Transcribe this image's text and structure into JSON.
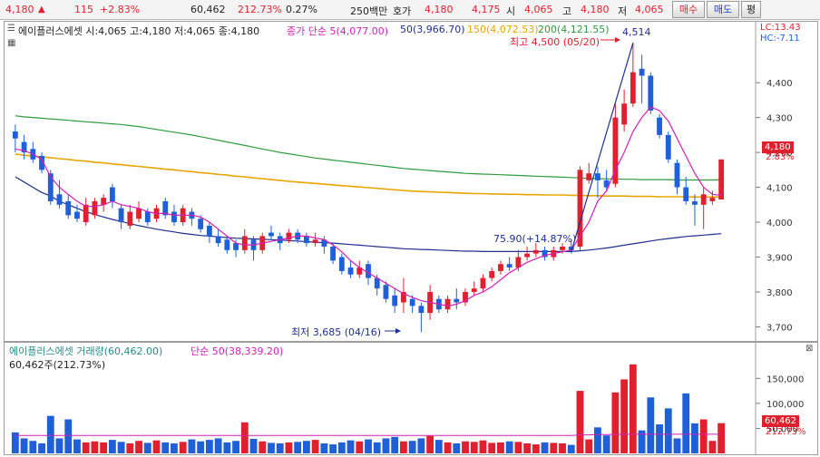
{
  "quote_bar": {
    "price": "4,180",
    "change_arrow": "▲",
    "change": "115",
    "change_pct": "+2.83%",
    "volume": "60,462",
    "volume_ratio": "212.73%",
    "turnover": "0.27%",
    "trade_value": "250백만",
    "ask_label": "호가",
    "ask1": "4,180",
    "ask2": "4,175",
    "open_label": "시",
    "open": "4,065",
    "high_label": "고",
    "high": "4,180",
    "low_label": "저",
    "low": "4,065",
    "buy_button": "매수",
    "sell_button": "매도",
    "eval_button": "평"
  },
  "colors": {
    "up": "#e0202e",
    "down": "#1f5fd8",
    "ma5": "#d21fb4",
    "ma50": "#1f2f8f",
    "ma150": "#e8a500",
    "ma200": "#2e9a3e",
    "vol_ma": "#d21fb4"
  },
  "legend": {
    "stock": "에이플러스에셋 시:4,065 고:4,180 저:4,065 종:4,180",
    "ma5": "종가 단순 5(4,077.00)",
    "ma50": "50(3,966.70)",
    "ma150": "150(4,072.53)",
    "ma200": "200(4,121.55)",
    "lc": "LC:13.43",
    "hc": "HC:-7.11"
  },
  "annotations": {
    "high_marker": "최고 4,500 (05/20)",
    "peak": "4,514",
    "low_marker": "최저 3,685 (04/16)",
    "trend": "75.90(+14.87%)"
  },
  "price_tag": {
    "price": "4,180",
    "pct": "2.83%"
  },
  "volume_legend": {
    "series": "에이플러스에셋 거래량(60,462.00)",
    "ma": "단순 50(38,339.20)",
    "last": "60,462주(212.73%)"
  },
  "volume_tag": {
    "value": "60,462",
    "pct": "212.73%"
  },
  "chart_data": {
    "type": "candlestick",
    "price_axis": {
      "ticks": [
        "4,400",
        "4,300",
        "4,200",
        "4,100",
        "4,000",
        "3,900",
        "3,800",
        "3,700"
      ],
      "ylim": [
        3670,
        4520
      ]
    },
    "volume_axis": {
      "ticks": [
        "150,000",
        "100,000",
        "50,000"
      ],
      "ylim": [
        0,
        185000
      ]
    },
    "candles": [
      [
        4260,
        4240,
        4280,
        4200
      ],
      [
        4230,
        4200,
        4250,
        4180
      ],
      [
        4210,
        4180,
        4230,
        4170
      ],
      [
        4190,
        4150,
        4200,
        4140
      ],
      [
        4140,
        4060,
        4150,
        4050
      ],
      [
        4080,
        4050,
        4120,
        4040
      ],
      [
        4060,
        4020,
        4080,
        4010
      ],
      [
        4030,
        4010,
        4050,
        4000
      ],
      [
        4000,
        4050,
        4070,
        3990
      ],
      [
        4020,
        4060,
        4070,
        4010
      ],
      [
        4050,
        4070,
        4080,
        4030
      ],
      [
        4100,
        4060,
        4110,
        4040
      ],
      [
        4040,
        4000,
        4050,
        3980
      ],
      [
        3990,
        4030,
        4050,
        3980
      ],
      [
        4010,
        4040,
        4060,
        4000
      ],
      [
        4030,
        4000,
        4040,
        3990
      ],
      [
        4010,
        4040,
        4050,
        4000
      ],
      [
        4060,
        4020,
        4070,
        4010
      ],
      [
        4030,
        4000,
        4050,
        3990
      ],
      [
        4000,
        4040,
        4050,
        3990
      ],
      [
        4030,
        4010,
        4040,
        3990
      ],
      [
        4010,
        3980,
        4020,
        3970
      ],
      [
        3990,
        3960,
        4000,
        3940
      ],
      [
        3960,
        3940,
        3980,
        3930
      ],
      [
        3950,
        3920,
        3960,
        3910
      ],
      [
        3940,
        3920,
        3950,
        3900
      ],
      [
        3920,
        3960,
        3980,
        3910
      ],
      [
        3950,
        3920,
        3960,
        3890
      ],
      [
        3920,
        3960,
        3970,
        3910
      ],
      [
        3970,
        3960,
        3990,
        3950
      ],
      [
        3960,
        3940,
        3970,
        3920
      ],
      [
        3950,
        3970,
        3980,
        3940
      ],
      [
        3970,
        3950,
        3980,
        3940
      ],
      [
        3960,
        3940,
        3970,
        3930
      ],
      [
        3940,
        3950,
        3970,
        3930
      ],
      [
        3950,
        3930,
        3960,
        3910
      ],
      [
        3930,
        3890,
        3940,
        3880
      ],
      [
        3900,
        3860,
        3910,
        3850
      ],
      [
        3870,
        3850,
        3890,
        3840
      ],
      [
        3850,
        3870,
        3890,
        3840
      ],
      [
        3880,
        3840,
        3890,
        3820
      ],
      [
        3840,
        3810,
        3850,
        3790
      ],
      [
        3820,
        3780,
        3830,
        3770
      ],
      [
        3790,
        3760,
        3810,
        3740
      ],
      [
        3770,
        3800,
        3840,
        3740
      ],
      [
        3780,
        3760,
        3790,
        3740
      ],
      [
        3760,
        3740,
        3770,
        3685
      ],
      [
        3740,
        3800,
        3820,
        3720
      ],
      [
        3780,
        3750,
        3790,
        3740
      ],
      [
        3750,
        3780,
        3790,
        3740
      ],
      [
        3780,
        3770,
        3810,
        3750
      ],
      [
        3770,
        3800,
        3810,
        3760
      ],
      [
        3800,
        3810,
        3830,
        3790
      ],
      [
        3810,
        3840,
        3850,
        3800
      ],
      [
        3840,
        3860,
        3870,
        3830
      ],
      [
        3860,
        3880,
        3890,
        3850
      ],
      [
        3880,
        3870,
        3900,
        3860
      ],
      [
        3870,
        3900,
        3920,
        3860
      ],
      [
        3900,
        3910,
        3930,
        3890
      ],
      [
        3910,
        3920,
        3940,
        3900
      ],
      [
        3920,
        3900,
        3930,
        3890
      ],
      [
        3900,
        3920,
        3930,
        3890
      ],
      [
        3920,
        3930,
        3940,
        3910
      ],
      [
        3930,
        3920,
        3950,
        3910
      ],
      [
        3930,
        4150,
        4160,
        3920
      ],
      [
        4120,
        4140,
        4170,
        4110
      ],
      [
        4140,
        4120,
        4160,
        4070
      ],
      [
        4120,
        4100,
        4150,
        4090
      ],
      [
        4110,
        4300,
        4340,
        4100
      ],
      [
        4280,
        4340,
        4380,
        4260
      ],
      [
        4340,
        4430,
        4514,
        4330
      ],
      [
        4440,
        4420,
        4480,
        4340
      ],
      [
        4420,
        4320,
        4430,
        4310
      ],
      [
        4300,
        4250,
        4310,
        4240
      ],
      [
        4250,
        4180,
        4260,
        4170
      ],
      [
        4170,
        4100,
        4180,
        4080
      ],
      [
        4100,
        4060,
        4130,
        4050
      ],
      [
        4060,
        4050,
        4080,
        3990
      ],
      [
        4050,
        4080,
        4100,
        3980
      ],
      [
        4060,
        4070,
        4090,
        4050
      ],
      [
        4065,
        4180,
        4180,
        4065
      ]
    ],
    "volume": [
      42000,
      30000,
      25000,
      20000,
      75000,
      30000,
      68000,
      28000,
      22000,
      24000,
      22000,
      27000,
      23000,
      20000,
      25000,
      21000,
      26000,
      22000,
      20000,
      23000,
      28000,
      24000,
      27000,
      30000,
      22000,
      25000,
      62000,
      29000,
      24000,
      21000,
      20000,
      22000,
      23000,
      25000,
      27000,
      20000,
      18000,
      22000,
      26000,
      24000,
      28000,
      22000,
      30000,
      33000,
      24000,
      25000,
      30000,
      35000,
      27000,
      22000,
      20000,
      24000,
      23000,
      26000,
      21000,
      22000,
      24000,
      23000,
      20000,
      18000,
      22000,
      21000,
      20000,
      17000,
      125000,
      28000,
      52000,
      36000,
      122000,
      148000,
      178000,
      46000,
      112000,
      58000,
      90000,
      30000,
      120000,
      60000,
      68000,
      25000,
      60462
    ],
    "ma5": [
      4210,
      4205,
      4195,
      4180,
      4130,
      4100,
      4080,
      4060,
      4045,
      4045,
      4050,
      4060,
      4050,
      4045,
      4040,
      4030,
      4025,
      4025,
      4020,
      4020,
      4020,
      4015,
      4000,
      3980,
      3960,
      3940,
      3935,
      3935,
      3940,
      3945,
      3950,
      3955,
      3960,
      3960,
      3955,
      3950,
      3935,
      3915,
      3890,
      3870,
      3855,
      3840,
      3825,
      3810,
      3795,
      3785,
      3775,
      3770,
      3765,
      3760,
      3765,
      3775,
      3790,
      3800,
      3815,
      3835,
      3855,
      3870,
      3885,
      3895,
      3905,
      3910,
      3915,
      3920,
      3960,
      4000,
      4060,
      4090,
      4150,
      4200,
      4260,
      4300,
      4330,
      4320,
      4290,
      4240,
      4190,
      4140,
      4100,
      4080,
      4077
    ],
    "ma50": [
      4130,
      4115,
      4100,
      4085,
      4075,
      4060,
      4050,
      4040,
      4030,
      4022,
      4015,
      4008,
      4002,
      3996,
      3990,
      3985,
      3980,
      3976,
      3972,
      3968,
      3965,
      3962,
      3960,
      3958,
      3956,
      3954,
      3953,
      3952,
      3951,
      3950,
      3949,
      3947,
      3946,
      3944,
      3943,
      3941,
      3940,
      3938,
      3936,
      3934,
      3932,
      3930,
      3928,
      3926,
      3924,
      3923,
      3922,
      3921,
      3920,
      3919,
      3918,
      3917,
      3917,
      3916,
      3916,
      3916,
      3916,
      3916,
      3916,
      3916,
      3916,
      3916,
      3916,
      3916,
      3918,
      3920,
      3923,
      3926,
      3930,
      3934,
      3938,
      3942,
      3946,
      3950,
      3953,
      3956,
      3959,
      3961,
      3963,
      3965,
      3967
    ],
    "ma150": [
      4195,
      4192,
      4190,
      4187,
      4185,
      4182,
      4180,
      4177,
      4175,
      4172,
      4170,
      4167,
      4165,
      4162,
      4160,
      4157,
      4155,
      4152,
      4150,
      4147,
      4145,
      4142,
      4140,
      4137,
      4135,
      4132,
      4130,
      4127,
      4125,
      4122,
      4120,
      4117,
      4115,
      4113,
      4111,
      4109,
      4107,
      4105,
      4103,
      4101,
      4099,
      4097,
      4095,
      4093,
      4091,
      4089,
      4088,
      4087,
      4086,
      4085,
      4084,
      4083,
      4082,
      4082,
      4081,
      4081,
      4080,
      4080,
      4079,
      4079,
      4078,
      4078,
      4078,
      4077,
      4077,
      4076,
      4076,
      4075,
      4075,
      4075,
      4074,
      4074,
      4074,
      4073,
      4073,
      4073,
      4073,
      4072,
      4072,
      4072,
      4073
    ],
    "ma200": [
      4305,
      4302,
      4300,
      4298,
      4296,
      4294,
      4292,
      4290,
      4288,
      4286,
      4284,
      4282,
      4280,
      4277,
      4274,
      4270,
      4266,
      4262,
      4258,
      4254,
      4250,
      4245,
      4240,
      4235,
      4230,
      4225,
      4220,
      4215,
      4210,
      4205,
      4200,
      4196,
      4192,
      4188,
      4184,
      4181,
      4178,
      4175,
      4172,
      4169,
      4166,
      4163,
      4160,
      4157,
      4154,
      4152,
      4150,
      4148,
      4146,
      4144,
      4142,
      4140,
      4139,
      4138,
      4137,
      4136,
      4135,
      4134,
      4133,
      4132,
      4131,
      4130,
      4129,
      4128,
      4127,
      4126,
      4125,
      4124,
      4124,
      4123,
      4123,
      4122,
      4122,
      4122,
      4122,
      4121,
      4121,
      4121,
      4121,
      4121,
      4122
    ],
    "vol_ma50": [
      36000,
      36000,
      36000,
      36000,
      36000,
      36000,
      36000,
      36000,
      36000,
      36000,
      36000,
      36000,
      36000,
      36000,
      36000,
      36000,
      36000,
      36000,
      36000,
      36000,
      36000,
      36000,
      36000,
      36000,
      36000,
      36000,
      36000,
      36000,
      36000,
      36000,
      36000,
      36000,
      36000,
      36000,
      36000,
      36000,
      36000,
      36000,
      36000,
      36000,
      36000,
      36000,
      36000,
      36000,
      36000,
      36000,
      36000,
      36000,
      36000,
      36000,
      36000,
      36000,
      36000,
      36000,
      36000,
      36000,
      36000,
      36000,
      36000,
      36000,
      36000,
      36000,
      36000,
      36000,
      37000,
      37000,
      37500,
      37500,
      38000,
      38000,
      38300,
      38300,
      38300,
      38300,
      38300,
      38300,
      38300,
      38300,
      38300,
      38300,
      38339
    ]
  }
}
